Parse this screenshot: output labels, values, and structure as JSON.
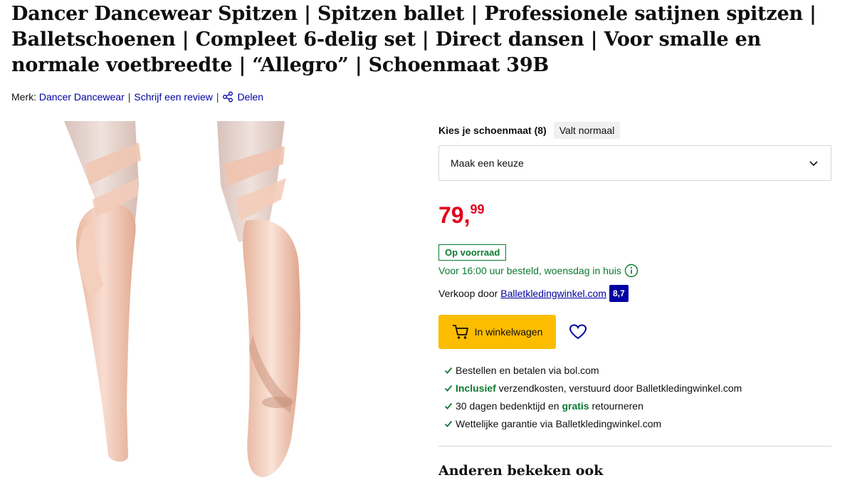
{
  "product": {
    "title": "Dancer Dancewear Spitzen | Spitzen ballet | Professionele satijnen spitzen | Balletschoenen | Compleet 6-delig set | Direct dansen | Voor smalle en normale voetbreedte | “Allegro” | Schoenmaat 39B"
  },
  "meta": {
    "brand_label": "Merk:",
    "brand_name": "Dancer Dancewear",
    "review_link": "Schrijf een review",
    "share_link": "Delen"
  },
  "size": {
    "label": "Kies je schoenmaat (8)",
    "fit_note": "Valt normaal",
    "select_placeholder": "Maak een keuze"
  },
  "price": {
    "integer": "79,",
    "decimals": "99"
  },
  "availability": {
    "stock": "Op voorraad",
    "delivery": "Voor 16:00 uur besteld, woensdag in huis"
  },
  "seller": {
    "prefix": "Verkoop door",
    "name": "Balletkledingwinkel.com",
    "rating": "8,7"
  },
  "actions": {
    "cart_label": "In winkelwagen"
  },
  "usps": [
    {
      "bold": "",
      "text": "Bestellen en betalen via bol.com"
    },
    {
      "bold": "Inclusief",
      "text": " verzendkosten, verstuurd door Balletkledingwinkel.com"
    },
    {
      "pre": "30 dagen bedenktijd en ",
      "bold": "gratis",
      "text": " retourneren"
    },
    {
      "bold": "",
      "text": "Wettelijke garantie via Balletkledingwinkel.com"
    }
  ],
  "section": {
    "others_viewed": "Anderen bekeken ook"
  },
  "colors": {
    "price_red": "#e0001b",
    "stock_green": "#0a7a2f",
    "link_blue": "#0000a4",
    "cart_yellow": "#fcbd00"
  },
  "icons": [
    "share-icon",
    "chevron-down-icon",
    "info-icon",
    "cart-icon",
    "heart-icon",
    "check-icon"
  ]
}
